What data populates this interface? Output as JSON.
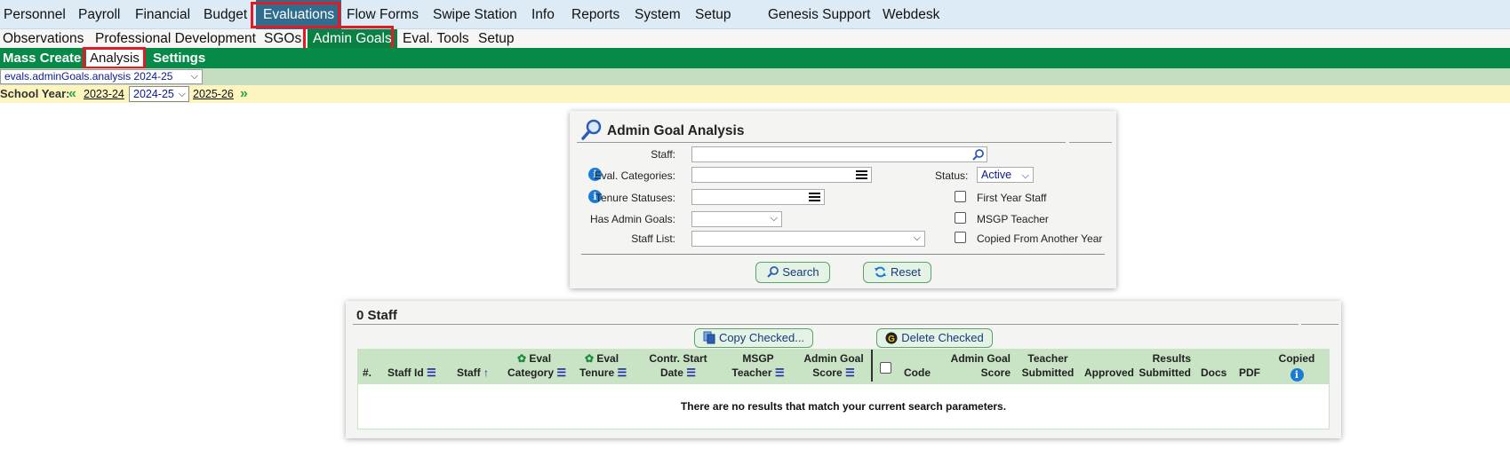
{
  "nav_main": [
    "Personnel",
    "Payroll",
    "Financial",
    "Budget",
    "Evaluations",
    "Flow Forms",
    "Swipe Station",
    "Info",
    "Reports",
    "System",
    "Setup",
    "Genesis Support",
    "Webdesk"
  ],
  "nav_sub": [
    "Observations",
    "Professional Development",
    "SGOs",
    "Admin Goals",
    "Eval. Tools",
    "Setup"
  ],
  "nav_third": [
    "Mass Create",
    "Analysis",
    "Settings"
  ],
  "view_select": "evals.adminGoals.analysis 2024-25",
  "school_year": {
    "label": "School Year:",
    "prev": "2023-24",
    "current": "2024-25",
    "next": "2025-26"
  },
  "search_panel": {
    "title": "Admin Goal Analysis",
    "staff_label": "Staff:",
    "eval_categories_label": "Eval. Categories:",
    "tenure_statuses_label": "Tenure Statuses:",
    "has_admin_goals_label": "Has Admin Goals:",
    "staff_list_label": "Staff List:",
    "status_label": "Status:",
    "status_value": "Active",
    "first_year_label": "First Year Staff",
    "msgp_label": "MSGP Teacher",
    "copied_label": "Copied From Another Year",
    "search_button": "Search",
    "reset_button": "Reset"
  },
  "results": {
    "title": "0 Staff",
    "copy_button": "Copy Checked...",
    "delete_button": "Delete Checked",
    "columns": {
      "num": "#.",
      "staff_id": "Staff Id",
      "staff": "Staff",
      "eval_cat_1": "Eval",
      "eval_cat_2": "Category",
      "eval_ten_1": "Eval",
      "eval_ten_2": "Tenure",
      "contr_1": "Contr. Start",
      "contr_2": "Date",
      "msgp_1": "MSGP",
      "msgp_2": "Teacher",
      "ags_1": "Admin Goal",
      "ags_2": "Score",
      "code": "Code",
      "agscore_1": "Admin Goal",
      "agscore_2": "Score",
      "teacher_1": "Teacher",
      "teacher_2": "Submitted",
      "approved": "Approved",
      "results_1": "Results",
      "results_2": "Submitted",
      "docs": "Docs",
      "pdf": "PDF",
      "copied": "Copied"
    },
    "empty_message": "There are no results that match your current search parameters."
  },
  "colors": {
    "nav_active": "#2f6d8e",
    "green_bar": "#078a47",
    "highlight_box": "#e01b24",
    "table_header": "#c9e3c5"
  }
}
